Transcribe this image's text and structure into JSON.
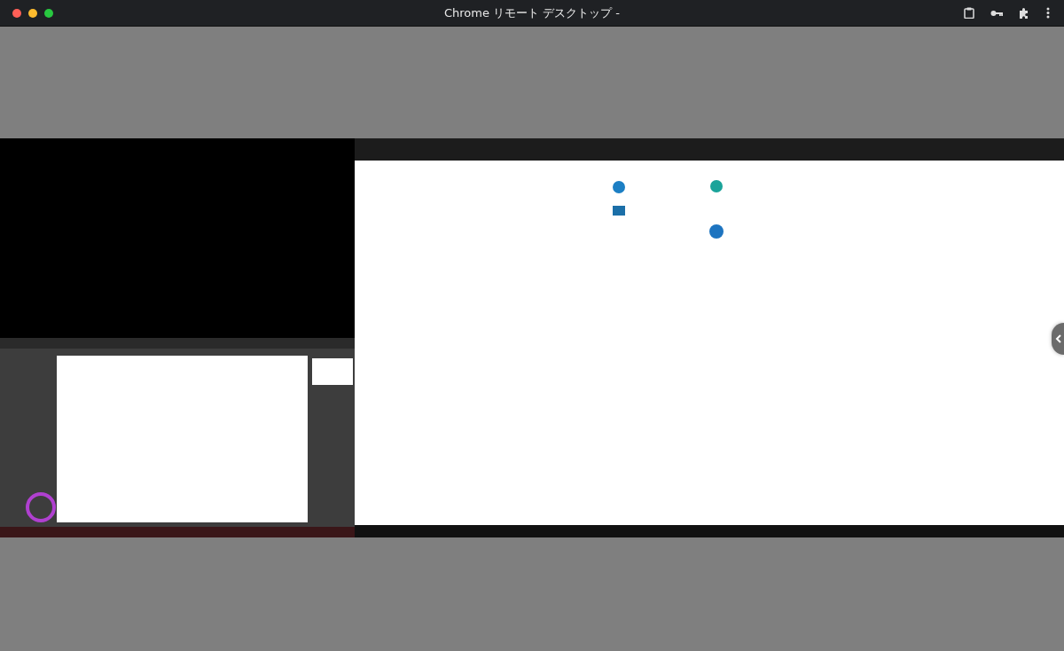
{
  "window": {
    "title": "Chrome リモート デスクトップ -"
  }
}
